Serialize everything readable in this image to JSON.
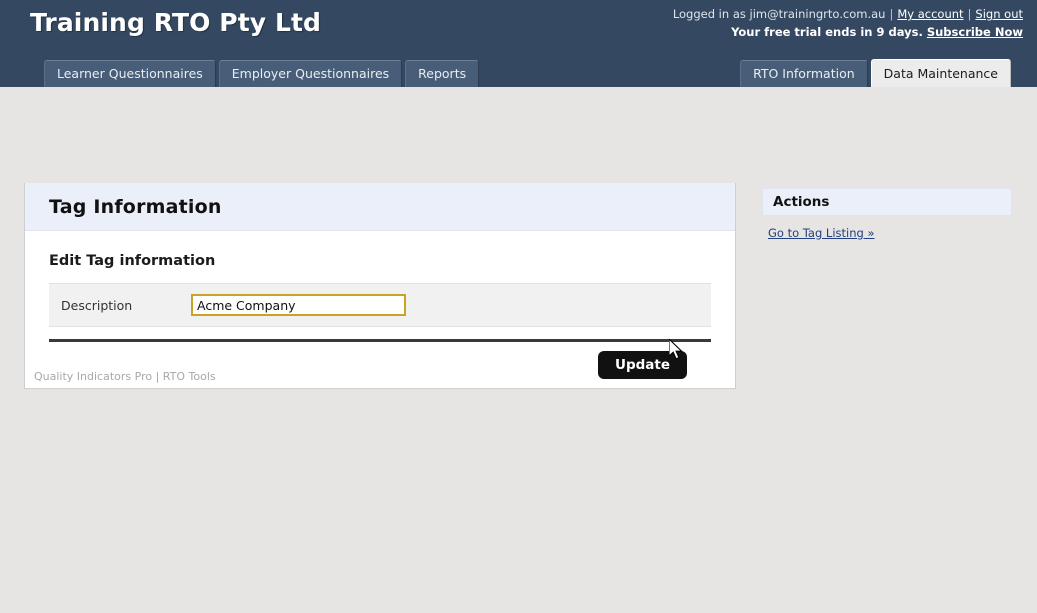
{
  "header": {
    "brand": "Training RTO Pty Ltd",
    "logged_in_prefix": "Logged in as ",
    "user_email": "jim@trainingrto.com.au",
    "my_account_label": "My account",
    "sign_out_label": "Sign out",
    "trial_text": "Your free trial ends in 9 days.",
    "subscribe_label": "Subscribe Now"
  },
  "tabs": {
    "left": [
      {
        "label": "Learner Questionnaires",
        "active": false
      },
      {
        "label": "Employer Questionnaires",
        "active": false
      },
      {
        "label": "Reports",
        "active": false
      }
    ],
    "right": [
      {
        "label": "RTO Information",
        "active": false
      },
      {
        "label": "Data Maintenance",
        "active": true
      }
    ]
  },
  "main": {
    "page_title": "Tag Information",
    "section_heading": "Edit Tag information",
    "form": {
      "description_label": "Description",
      "description_value": "Acme Company",
      "description_placeholder": ""
    },
    "update_button": "Update"
  },
  "sidebar": {
    "title": "Actions",
    "links": [
      {
        "label": "Go to Tag Listing »"
      }
    ]
  },
  "footer": {
    "text": "Quality Indicators Pro | RTO Tools"
  },
  "colors": {
    "header_bg": "#344961",
    "page_bg": "#e6e5e3",
    "panel_title_bg": "#eaeff9",
    "input_border": "#c9a227",
    "button_bg": "#111111",
    "link": "#24407e"
  }
}
